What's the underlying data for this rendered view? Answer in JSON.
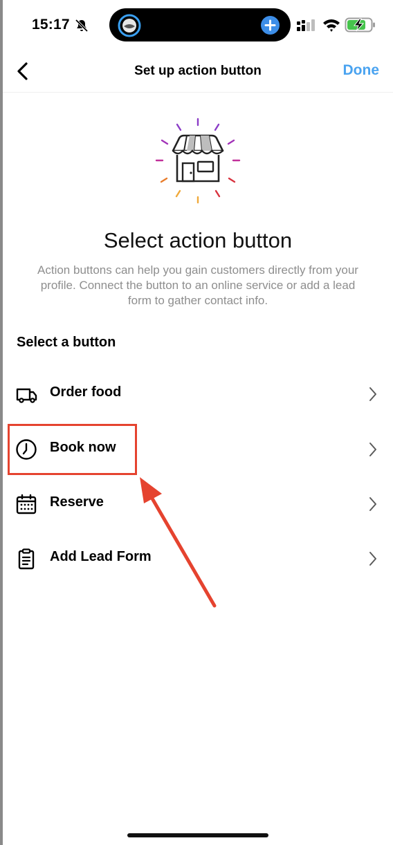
{
  "status_bar": {
    "time": "15:17",
    "icons": [
      "bell-slash-icon",
      "app-activity-icon",
      "plus-circle-icon",
      "signal-icon",
      "wifi-icon",
      "battery-charging-icon"
    ]
  },
  "header": {
    "title": "Set up action button",
    "done_label": "Done",
    "back_icon": "chevron-left-icon"
  },
  "hero": {
    "illustration": "storefront-icon",
    "heading": "Select action button",
    "description": "Action buttons can help you gain customers directly from your profile. Connect the button to an online service or add a lead form to gather contact info."
  },
  "section_label": "Select a button",
  "options": [
    {
      "label": "Order food",
      "icon": "delivery-truck-icon"
    },
    {
      "label": "Book now",
      "icon": "clock-icon"
    },
    {
      "label": "Reserve",
      "icon": "calendar-icon"
    },
    {
      "label": "Add Lead Form",
      "icon": "clipboard-icon"
    }
  ],
  "annotation": {
    "highlighted_option": "Book now",
    "color": "#e5432f"
  },
  "colors": {
    "accent": "#4aa3f0",
    "secondary_text": "#8e8e8e"
  }
}
